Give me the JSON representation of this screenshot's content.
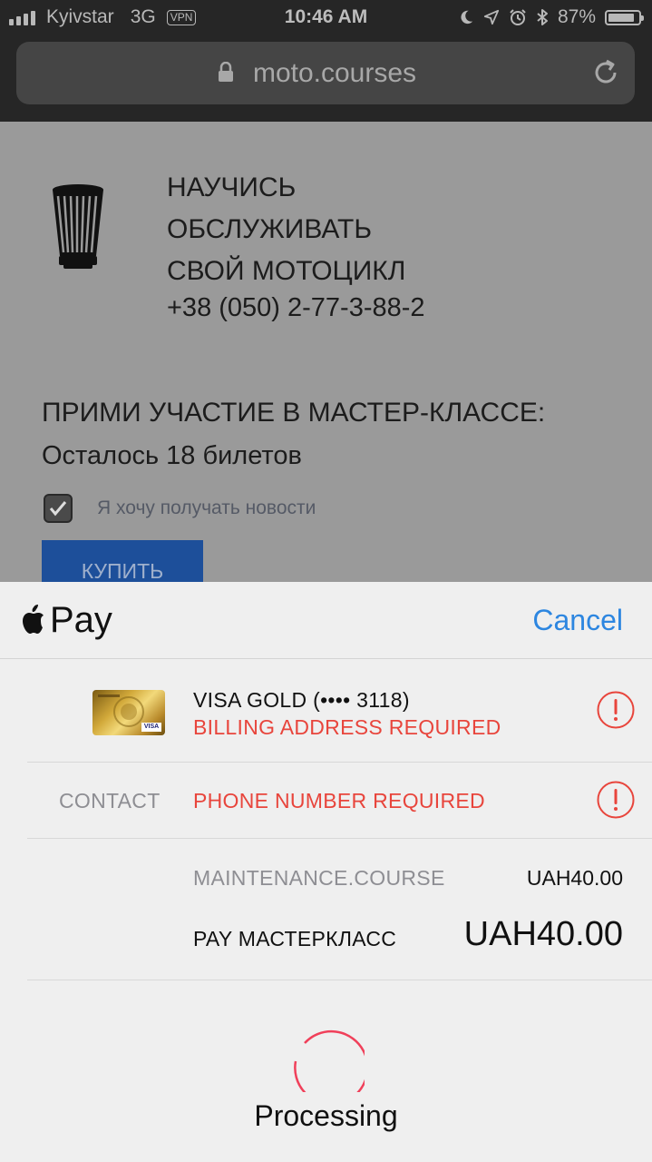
{
  "status": {
    "carrier": "Kyivstar",
    "network": "3G",
    "vpn": "VPN",
    "time": "10:46 AM",
    "battery": "87%",
    "battery_level": 0.87
  },
  "browser": {
    "url": "moto.courses"
  },
  "page": {
    "brand_line1": "НАУЧИСЬ",
    "brand_line2": "ОБСЛУЖИВАТЬ",
    "brand_line3": "СВОЙ МОТОЦИКЛ",
    "phone": "+38 (050) 2-77-3-88-2",
    "heading": "ПРИМИ УЧАСТИЕ В МАСТЕР-КЛАССЕ:",
    "tickets_left": "Осталось 18 билетов",
    "newsletter_label": "Я хочу получать новости",
    "newsletter_checked": true,
    "buy_label": "КУПИТЬ"
  },
  "applepay": {
    "title": "Pay",
    "cancel_label": "Cancel",
    "card_name": "VISA GOLD (•••• 3118)",
    "card_error": "BILLING ADDRESS REQUIRED",
    "contact_label": "CONTACT",
    "contact_error": "PHONE NUMBER REQUIRED",
    "item_name": "MAINTENANCE.COURSE",
    "item_price": "UAH40.00",
    "pay_label": "PAY МАСТЕРКЛАСС",
    "pay_total": "UAH40.00",
    "processing_label": "Processing",
    "colors": {
      "accent": "#2d86e0",
      "error": "#e8453c",
      "spinner": "#f0405a"
    }
  }
}
